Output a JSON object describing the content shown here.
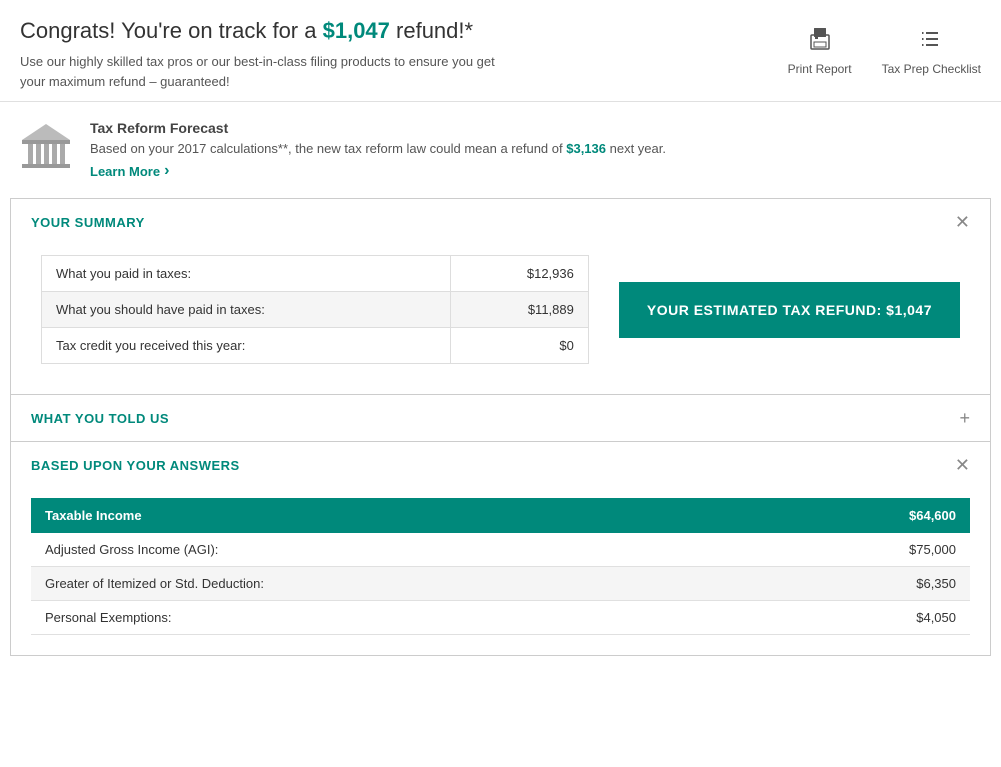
{
  "header": {
    "congrats_text": "Congrats! You're on track for a ",
    "refund_amount": "$1,047",
    "refund_suffix": " refund!*",
    "subtitle": "Use our highly skilled tax pros or our best-in-class filing products to ensure you get your maximum refund – guaranteed!",
    "print_label": "Print Report",
    "checklist_label": "Tax Prep Checklist"
  },
  "tax_reform": {
    "title": "Tax Reform Forecast",
    "description_pre": "Based on your 2017 calculations**, the new tax reform law could mean a refund of ",
    "forecast_amount": "$3,136",
    "description_post": " next year.",
    "learn_more": "Learn More"
  },
  "your_summary": {
    "title": "YOUR SUMMARY",
    "rows": [
      {
        "label": "What you paid in taxes:",
        "value": "$12,936"
      },
      {
        "label": "What you should have paid in taxes:",
        "value": "$11,889"
      },
      {
        "label": "Tax credit you received this year:",
        "value": "$0"
      }
    ],
    "refund_box_label": "YOUR ESTIMATED TAX REFUND:",
    "refund_box_value": "$1,047"
  },
  "what_you_told_us": {
    "title": "WHAT YOU TOLD US"
  },
  "based_upon": {
    "title": "BASED UPON YOUR ANSWERS",
    "table_header_label": "Taxable Income",
    "table_header_value": "$64,600",
    "rows": [
      {
        "label": "Adjusted Gross Income (AGI):",
        "value": "$75,000"
      },
      {
        "label": "Greater of Itemized or Std. Deduction:",
        "value": "$6,350"
      },
      {
        "label": "Personal Exemptions:",
        "value": "$4,050"
      }
    ]
  }
}
